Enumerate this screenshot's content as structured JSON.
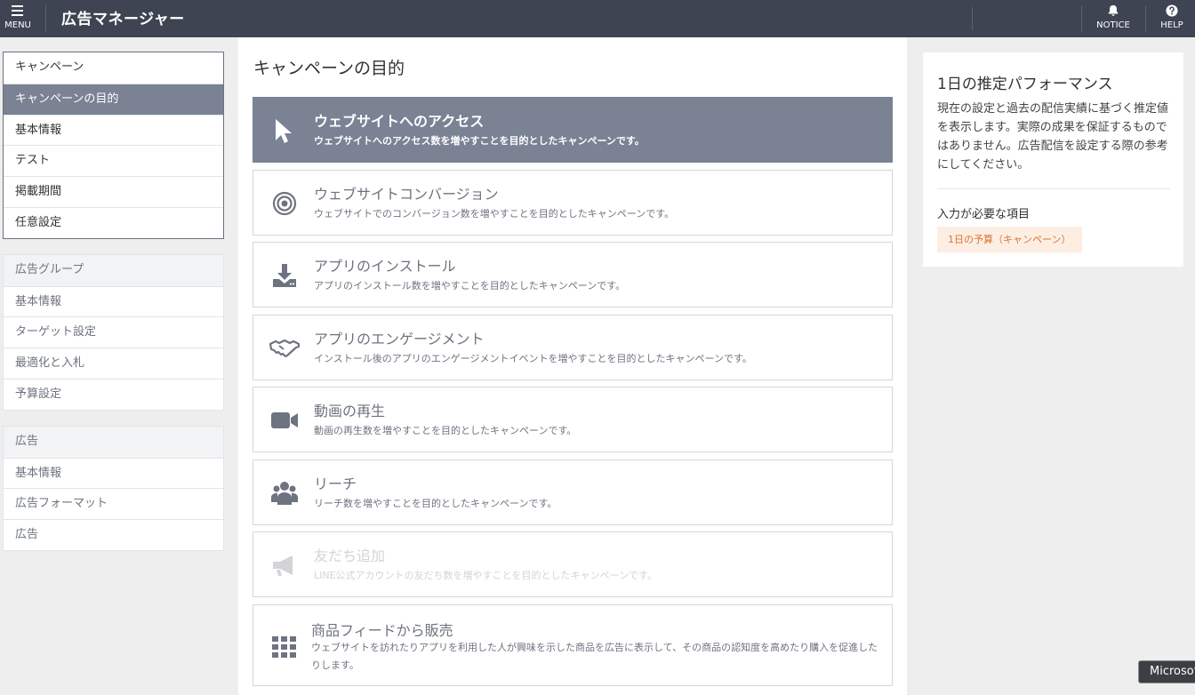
{
  "topbar": {
    "menu_label": "MENU",
    "app_title": "広告マネージャー",
    "notice_label": "NOTICE",
    "help_label": "HELP"
  },
  "leftnav": {
    "campaign": [
      "キャンペーン",
      "キャンペーンの目的",
      "基本情報",
      "テスト",
      "掲載期間",
      "任意設定"
    ],
    "adgroup": [
      "広告グループ",
      "基本情報",
      "ターゲット設定",
      "最適化と入札",
      "予算設定"
    ],
    "ad": [
      "広告",
      "基本情報",
      "広告フォーマット",
      "広告"
    ]
  },
  "main": {
    "page_title": "キャンペーンの目的",
    "options": [
      {
        "icon": "cursor-icon",
        "title": "ウェブサイトへのアクセス",
        "desc": "ウェブサイトへのアクセス数を増やすことを目的としたキャンペーンです。",
        "state": "selected"
      },
      {
        "icon": "target-icon",
        "title": "ウェブサイトコンバージョン",
        "desc": "ウェブサイトでのコンバージョン数を増やすことを目的としたキャンペーンです。",
        "state": "normal"
      },
      {
        "icon": "download-icon",
        "title": "アプリのインストール",
        "desc": "アプリのインストール数を増やすことを目的としたキャンペーンです。",
        "state": "normal"
      },
      {
        "icon": "handshake-icon",
        "title": "アプリのエンゲージメント",
        "desc": "インストール後のアプリのエンゲージメントイベントを増やすことを目的としたキャンペーンです。",
        "state": "normal"
      },
      {
        "icon": "video-camera-icon",
        "title": "動画の再生",
        "desc": "動画の再生数を増やすことを目的としたキャンペーンです。",
        "state": "normal"
      },
      {
        "icon": "users-icon",
        "title": "リーチ",
        "desc": "リーチ数を増やすことを目的としたキャンペーンです。",
        "state": "normal"
      },
      {
        "icon": "megaphone-icon",
        "title": "友だち追加",
        "desc": "LINE公式アカウントの友だち数を増やすことを目的としたキャンペーンです。",
        "state": "disabled"
      },
      {
        "icon": "grid-icon",
        "title": "商品フィードから販売",
        "desc": "ウェブサイトを訪れたりアプリを利用した人が興味を示した商品を広告に表示して、その商品の認知度を高めたり購入を促進したりします。",
        "state": "normal"
      }
    ]
  },
  "rightpanel": {
    "title": "1日の推定パフォーマンス",
    "desc": "現在の設定と過去の配信実績に基づく推定値を表示します。実際の成果を保証するものではありません。広告配信を設定する際の参考にしてください。",
    "required_label": "入力が必要な項目",
    "required_badge": "1日の予算（キャンペーン）"
  },
  "taskbar_tooltip": "Microsoft"
}
